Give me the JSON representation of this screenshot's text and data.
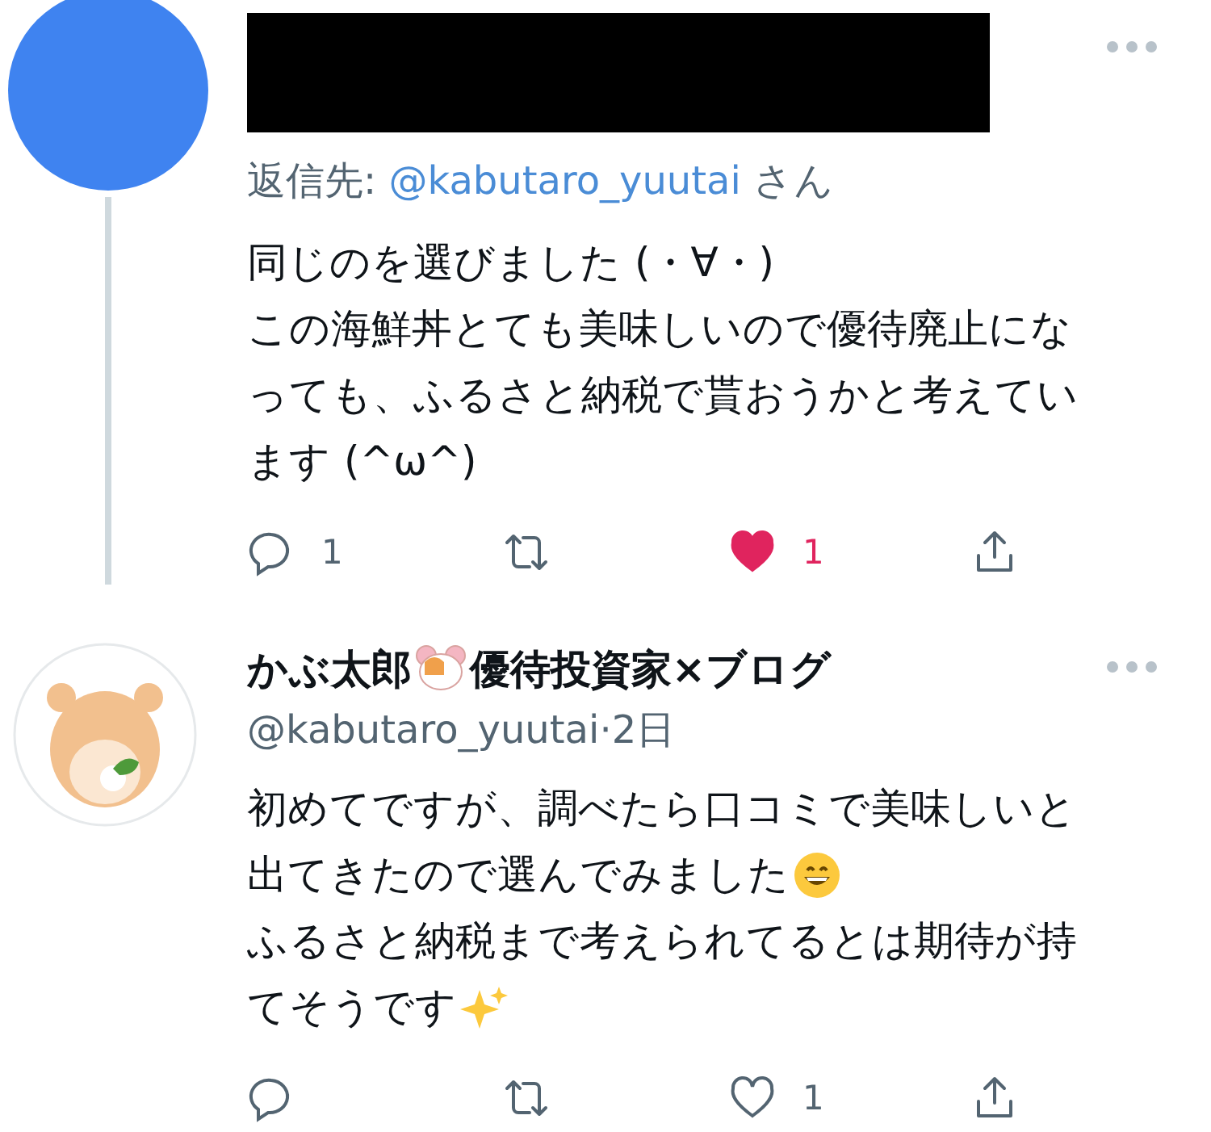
{
  "tweets": [
    {
      "avatar": {
        "kind": "plain",
        "color": "#3f83f0"
      },
      "redacted": true,
      "reply_to": {
        "prefix": "返信先:",
        "handle": "@kabutaro_yuutai",
        "suffix": "さん"
      },
      "lines": [
        {
          "kind": "plain",
          "text": "同じのを選びました (・∀・)"
        },
        {
          "kind": "plain",
          "text": "この海鮮丼とても美味しいので優待廃止にな"
        },
        {
          "kind": "plain",
          "text": "っても、ふるさと納税で貰おうかと考えてい"
        },
        {
          "kind": "plain",
          "text": "ます (^ω^)"
        }
      ],
      "actions": {
        "replies": "1",
        "liked": true,
        "likes": "1"
      }
    },
    {
      "avatar": {
        "kind": "drawing"
      },
      "redacted": false,
      "name": [
        "かぶ太郎",
        "優待投資家×ブログ"
      ],
      "handle": "@kabutaro_yuutai",
      "separator": "·",
      "time": "2日",
      "lines": [
        {
          "kind": "plain",
          "text": "初めてですが、調べたら口コミで美味しいと"
        },
        {
          "kind": "grin",
          "text": "出てきたので選んでみました"
        },
        {
          "kind": "plain",
          "text": "ふるさと納税まで考えられてるとは期待が持"
        },
        {
          "kind": "sparkles",
          "text": "てそうです"
        }
      ],
      "actions": {
        "liked": false,
        "likes": "1"
      }
    }
  ]
}
